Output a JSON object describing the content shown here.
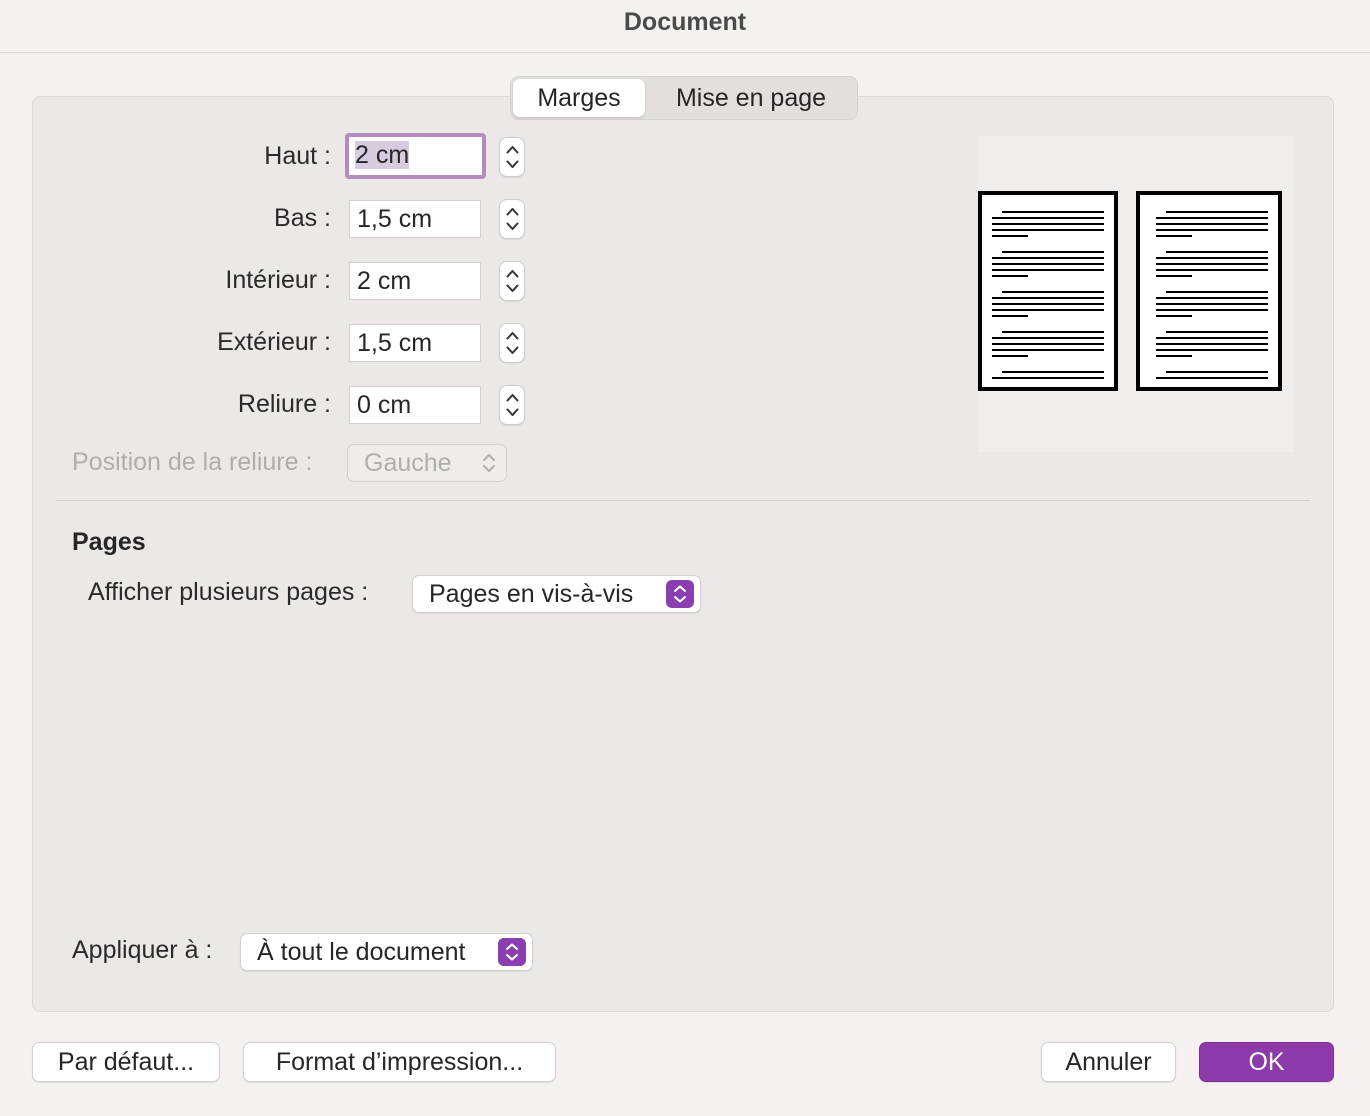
{
  "window": {
    "title": "Document"
  },
  "tabs": [
    {
      "label": "Marges",
      "active": true
    },
    {
      "label": "Mise en page",
      "active": false
    }
  ],
  "margins": {
    "top": {
      "label": "Haut :",
      "value": "2 cm"
    },
    "bottom": {
      "label": "Bas :",
      "value": "1,5 cm"
    },
    "inside": {
      "label": "Intérieur :",
      "value": "2 cm"
    },
    "outside": {
      "label": "Extérieur :",
      "value": "1,5 cm"
    },
    "gutter": {
      "label": "Reliure :",
      "value": "0 cm"
    },
    "gutter_position": {
      "label": "Position de la reliure :",
      "value": "Gauche",
      "enabled": false
    }
  },
  "pages": {
    "heading": "Pages",
    "multiple_label": "Afficher plusieurs pages :",
    "multiple_value": "Pages en vis-à-vis"
  },
  "apply": {
    "label": "Appliquer à :",
    "value": "À tout le document"
  },
  "buttons": {
    "default": "Par défaut...",
    "print_format": "Format d’impression...",
    "cancel": "Annuler",
    "ok": "OK"
  },
  "colors": {
    "accent": "#8c3aa9",
    "focus_ring": "#b48bbf",
    "background": "#f5f1f0",
    "panel": "#ebe8e7"
  },
  "icons": {
    "stepper": "stepper-arrows-icon",
    "popup": "popup-chevrons-icon",
    "preview": "facing-pages-preview-icon"
  }
}
